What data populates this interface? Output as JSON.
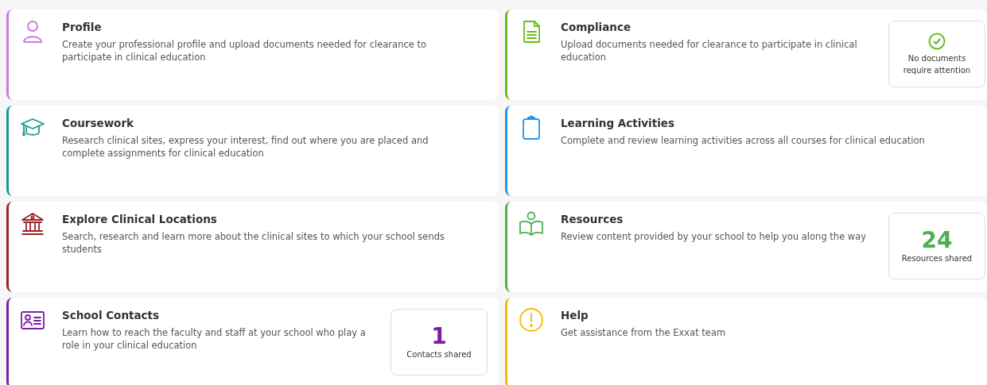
{
  "cards": [
    {
      "title": "Profile",
      "description": "Create your professional profile and upload documents needed for clearance to participate in clinical education",
      "color": "#c77be0"
    },
    {
      "title": "Compliance",
      "description": "Upload documents needed for clearance to participate in clinical education",
      "color": "#6cbb1e",
      "stat": {
        "kind": "status",
        "label": "No documents require attention"
      }
    },
    {
      "title": "Coursework",
      "description": "Research clinical sites, express your interest, find out where you are placed and complete assignments for clinical education",
      "color": "#17998a"
    },
    {
      "title": "Learning Activities",
      "description": "Complete and review learning activities across all courses for clinical education",
      "color": "#2196f3"
    },
    {
      "title": "Explore Clinical Locations",
      "description": "Search, research and learn more about the clinical sites to which your school sends students",
      "color": "#9b2226"
    },
    {
      "title": "Resources",
      "description": "Review content provided by your school to help you along the way",
      "color": "#4caf50",
      "stat": {
        "kind": "count",
        "value": "24",
        "label": "Resources shared"
      }
    },
    {
      "title": "School Contacts",
      "description": "Learn how to reach the faculty and staff at your school who play a role in your clinical education",
      "color": "#7b1fa2",
      "stat": {
        "kind": "count",
        "value": "1",
        "label": "Contacts shared"
      }
    },
    {
      "title": "Help",
      "description": "Get assistance from the Exxat team",
      "color": "#f5b800"
    }
  ]
}
